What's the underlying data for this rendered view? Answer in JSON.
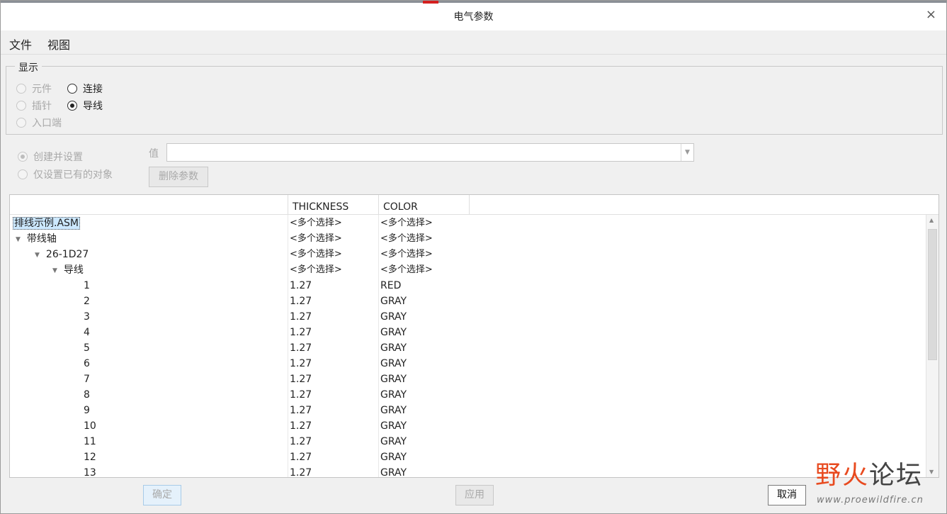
{
  "window": {
    "title": "电气参数",
    "close_glyph": "×"
  },
  "menu": {
    "file": "文件",
    "view": "视图"
  },
  "display": {
    "legend": "显示",
    "options": [
      {
        "label": "元件",
        "checked": false,
        "enabled": false
      },
      {
        "label": "插针",
        "checked": false,
        "enabled": false
      },
      {
        "label": "入口端",
        "checked": false,
        "enabled": false
      },
      {
        "label": "连接",
        "checked": false,
        "enabled": true
      },
      {
        "label": "导线",
        "checked": true,
        "enabled": true
      }
    ]
  },
  "mode": {
    "create_and_set": "创建并设置",
    "set_existing_only": "仅设置已有的对象",
    "value_label": "值",
    "value": "",
    "delete_param": "删除参数"
  },
  "table": {
    "columns": [
      "",
      "THICKNESS",
      "COLOR"
    ],
    "rows": [
      {
        "name": "排线示例.ASM",
        "level": 0,
        "expander": "",
        "thickness": "<多个选择>",
        "color": "<多个选择>",
        "selected": true
      },
      {
        "name": "带线轴",
        "level": 0,
        "expander": "▼",
        "thickness": "<多个选择>",
        "color": "<多个选择>"
      },
      {
        "name": "26-1D27",
        "level": 1,
        "expander": "▼",
        "thickness": "<多个选择>",
        "color": "<多个选择>"
      },
      {
        "name": "导线",
        "level": 2,
        "expander": "▼",
        "thickness": "<多个选择>",
        "color": "<多个选择>"
      },
      {
        "name": "1",
        "level": 3,
        "expander": "",
        "thickness": "1.27",
        "color": "RED"
      },
      {
        "name": "2",
        "level": 3,
        "expander": "",
        "thickness": "1.27",
        "color": "GRAY"
      },
      {
        "name": "3",
        "level": 3,
        "expander": "",
        "thickness": "1.27",
        "color": "GRAY"
      },
      {
        "name": "4",
        "level": 3,
        "expander": "",
        "thickness": "1.27",
        "color": "GRAY"
      },
      {
        "name": "5",
        "level": 3,
        "expander": "",
        "thickness": "1.27",
        "color": "GRAY"
      },
      {
        "name": "6",
        "level": 3,
        "expander": "",
        "thickness": "1.27",
        "color": "GRAY"
      },
      {
        "name": "7",
        "level": 3,
        "expander": "",
        "thickness": "1.27",
        "color": "GRAY"
      },
      {
        "name": "8",
        "level": 3,
        "expander": "",
        "thickness": "1.27",
        "color": "GRAY"
      },
      {
        "name": "9",
        "level": 3,
        "expander": "",
        "thickness": "1.27",
        "color": "GRAY"
      },
      {
        "name": "10",
        "level": 3,
        "expander": "",
        "thickness": "1.27",
        "color": "GRAY"
      },
      {
        "name": "11",
        "level": 3,
        "expander": "",
        "thickness": "1.27",
        "color": "GRAY"
      },
      {
        "name": "12",
        "level": 3,
        "expander": "",
        "thickness": "1.27",
        "color": "GRAY"
      },
      {
        "name": "13",
        "level": 3,
        "expander": "",
        "thickness": "1.27",
        "color": "GRAY"
      }
    ]
  },
  "buttons": {
    "ok": "确定",
    "apply": "应用",
    "cancel": "取消"
  },
  "watermark": {
    "brand_a": "野火",
    "brand_b": "论坛",
    "url": "www.proewildfire.cn"
  },
  "colors": {
    "accent": "#cce8ff",
    "brand": "#e84a1f"
  }
}
